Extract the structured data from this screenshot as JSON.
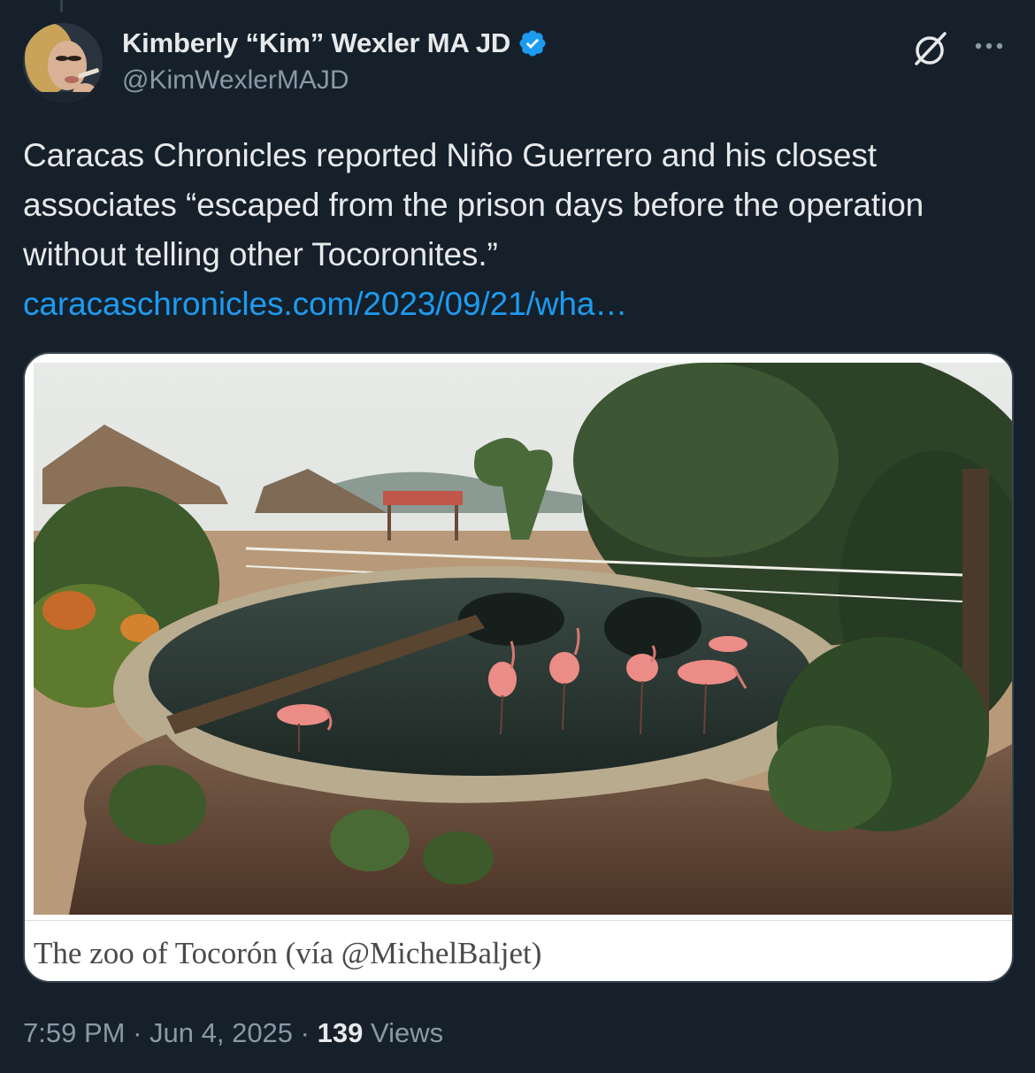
{
  "author": {
    "display_name": "Kimberly “Kim” Wexler MA JD",
    "handle": "@KimWexlerMAJD",
    "verified": true,
    "verified_color": "#1d9bf0"
  },
  "tweet": {
    "text": "Caracas Chronicles reported Niño Guerrero and his closest associates “escaped from the prison days before the operation without telling other Tocoronites.”",
    "link": "caracaschronicles.com/2023/09/21/wha…"
  },
  "media": {
    "caption": "The zoo of Tocorón (vía @MichelBaljet)"
  },
  "meta": {
    "time": "7:59 PM",
    "separator1": " · ",
    "date": "Jun 4, 2025",
    "separator2": " · ",
    "views_count": "139",
    "views_label": " Views"
  },
  "icons": {
    "grok": "grok-icon",
    "more": "more-icon",
    "verified": "verified-badge-icon"
  },
  "colors": {
    "background": "#15202b",
    "link": "#1d9bf0",
    "secondary_text": "#8b98a5"
  }
}
